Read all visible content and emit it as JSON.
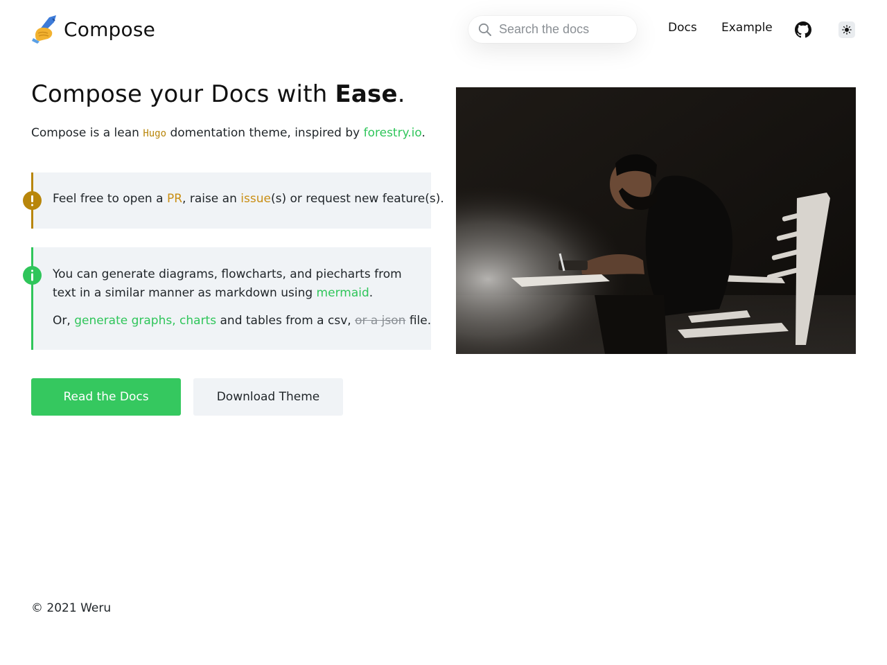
{
  "header": {
    "brand": "Compose",
    "search_placeholder": "Search the docs",
    "nav": [
      {
        "label": "Docs"
      },
      {
        "label": "Example"
      }
    ]
  },
  "hero": {
    "title_prefix": "Compose your Docs with ",
    "title_strong": "Ease",
    "title_suffix": ".",
    "subtitle": {
      "t1": "Compose is a lean ",
      "code": "Hugo",
      "t2": " domentation theme, inspired by ",
      "link": "forestry.io",
      "t3": "."
    }
  },
  "callouts": {
    "warning": {
      "t1": "Feel free to open a ",
      "link1": "PR",
      "t2": ", raise an ",
      "link2": "issue",
      "t3": "(s) or request new feature(s)."
    },
    "info": {
      "p1_text": "You can generate diagrams, flowcharts, and piecharts from text in a similar manner as markdown using ",
      "p1_link": "mermaid",
      "p1_end": ".",
      "p2_t1": "Or, ",
      "p2_link": "generate graphs, charts",
      "p2_t2": " and tables from a csv, ",
      "p2_strike": "or a json",
      "p2_t3": " file."
    }
  },
  "buttons": {
    "primary": "Read the Docs",
    "secondary": "Download Theme"
  },
  "footer": {
    "text": "© 2021 Weru"
  },
  "icons": {
    "logo": "writing-hand-icon",
    "search": "search-icon",
    "github": "github-icon",
    "theme": "sun-icon",
    "warning": "exclamation-icon",
    "info": "info-icon"
  },
  "colors": {
    "accent_green": "#35c85f",
    "link_green": "#2fc55a",
    "accent_gold": "#b8860b",
    "callout_bg": "#f0f3f6"
  }
}
